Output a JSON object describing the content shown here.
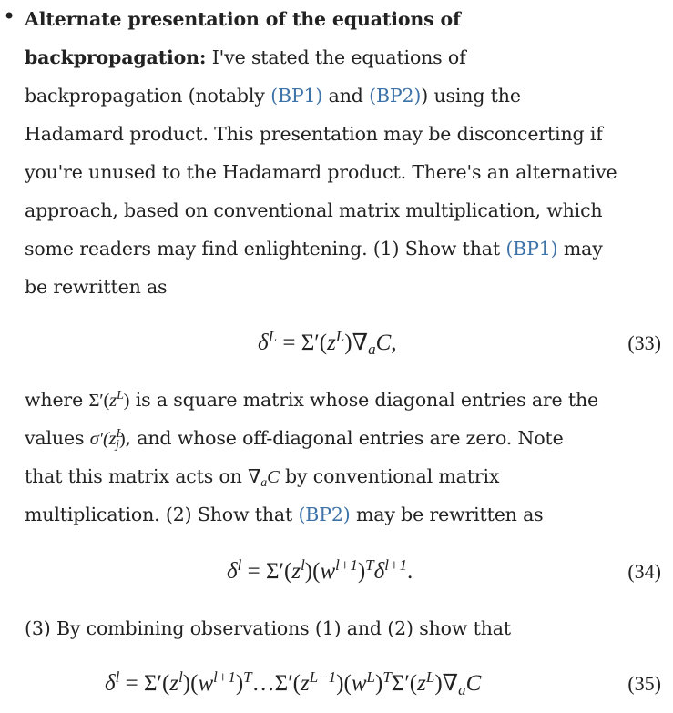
{
  "bullet": "•",
  "paragraph1": {
    "heading_l1": "Alternate presentation of the equations of",
    "heading_l2": "backpropagation:",
    "l2_rest": " I've stated the equations of",
    "l3_a": "backpropagation (notably ",
    "l3_ref1": "(BP1)",
    "l3_b": " and ",
    "l3_ref2": "(BP2)",
    "l3_c": ") using the",
    "l4": "Hadamard product. This presentation may be disconcerting if",
    "l5": "you're unused to the Hadamard product. There's an alternative",
    "l6": "approach, based on conventional matrix multiplication, which",
    "l7_a": "some readers may find enlightening. (1) Show that ",
    "l7_ref": "(BP1)",
    "l7_b": " may",
    "l8": "be rewritten as"
  },
  "eq33": {
    "delta": "δ",
    "sup_L": "L",
    "equals": "=",
    "Sigma": "Σ′(",
    "z": "z",
    "close": ")",
    "nabla": "∇",
    "sub_a": "a",
    "C": "C",
    "tail": ",",
    "number": "(33)"
  },
  "paragraph2": {
    "l1_a": "where ",
    "l1_math": "Σ′(",
    "l1_z": "z",
    "l1_sup": "L",
    "l1_close": ")",
    "l1_b": " is a square matrix whose diagonal entries are the",
    "l2_a": "values ",
    "l2_sigma": "σ′(",
    "l2_z": "z",
    "l2_sup": "L",
    "l2_sub": "j",
    "l2_close": ")",
    "l2_b": ", and whose off-diagonal entries are zero. Note",
    "l3_a": "that this matrix acts on ",
    "l3_nabla": "∇",
    "l3_sub": "a",
    "l3_C": "C",
    "l3_b": " by conventional matrix",
    "l4_a": "multiplication. (2) Show that ",
    "l4_ref": "(BP2)",
    "l4_b": " may be rewritten as"
  },
  "eq34": {
    "delta": "δ",
    "sup_l": "l",
    "equals": "=",
    "Sigma": "Σ′(",
    "z": "z",
    "close1": ")(",
    "w": "w",
    "sup_l1": "l+1",
    "close2": ")",
    "sup_T": "T",
    "delta2": "δ",
    "sup_l1b": "l+1",
    "tail": ".",
    "number": "(34)"
  },
  "paragraph3": {
    "text": "(3) By combining observations (1) and (2) show that"
  },
  "eq35": {
    "delta": "δ",
    "sup_l": "l",
    "equals": "=",
    "Sigma": "Σ′(",
    "z": "z",
    "close1": ")(",
    "w": "w",
    "sup_l1": "l+1",
    "close2": ")",
    "sup_T": "T",
    "dots": "…Σ′(",
    "sup_Lm1": "L−1",
    "close3": ")(",
    "sup_L": "L",
    "close4": ")",
    "sup_T2": "T",
    "Sigma2": "Σ′(",
    "close5": ")",
    "nabla": "∇",
    "sub_a": "a",
    "C": "C",
    "number": "(35)"
  }
}
